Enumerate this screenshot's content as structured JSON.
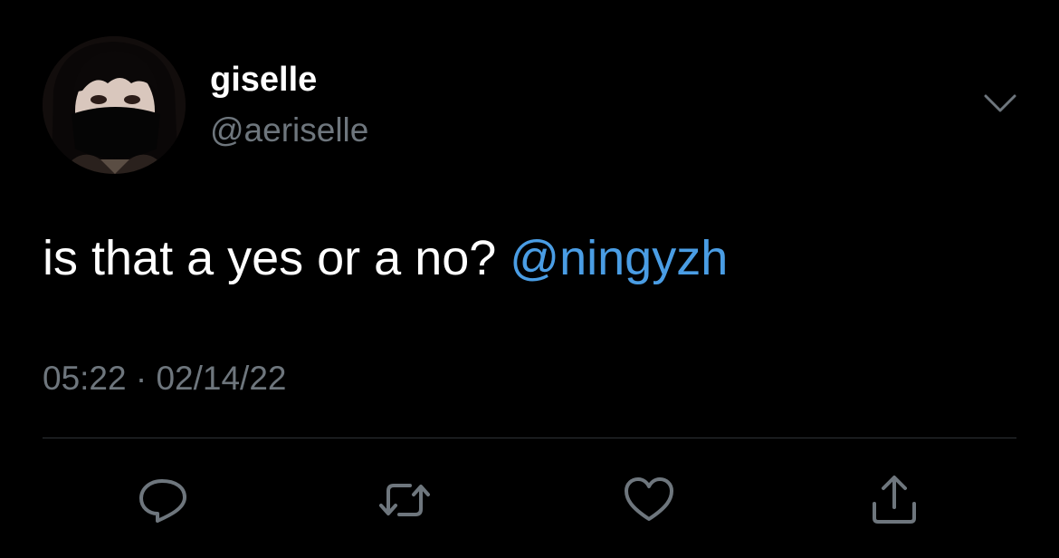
{
  "author": {
    "display_name": "giselle",
    "handle": "@aeriselle",
    "avatar_icon": "avatar-photo"
  },
  "tweet": {
    "text": "is that a yes or a no? ",
    "mention": "@ningyzh",
    "timestamp": "05:22 · 02/14/22"
  },
  "actions": [
    {
      "name": "reply",
      "icon": "reply-icon"
    },
    {
      "name": "retweet",
      "icon": "retweet-icon"
    },
    {
      "name": "like",
      "icon": "heart-icon"
    },
    {
      "name": "share",
      "icon": "share-icon"
    }
  ],
  "colors": {
    "background": "#000000",
    "primary_text": "#ffffff",
    "secondary_text": "#6e767d",
    "mention": "#4a9de4",
    "divider": "#2f3336",
    "icon": "#6e767d"
  }
}
